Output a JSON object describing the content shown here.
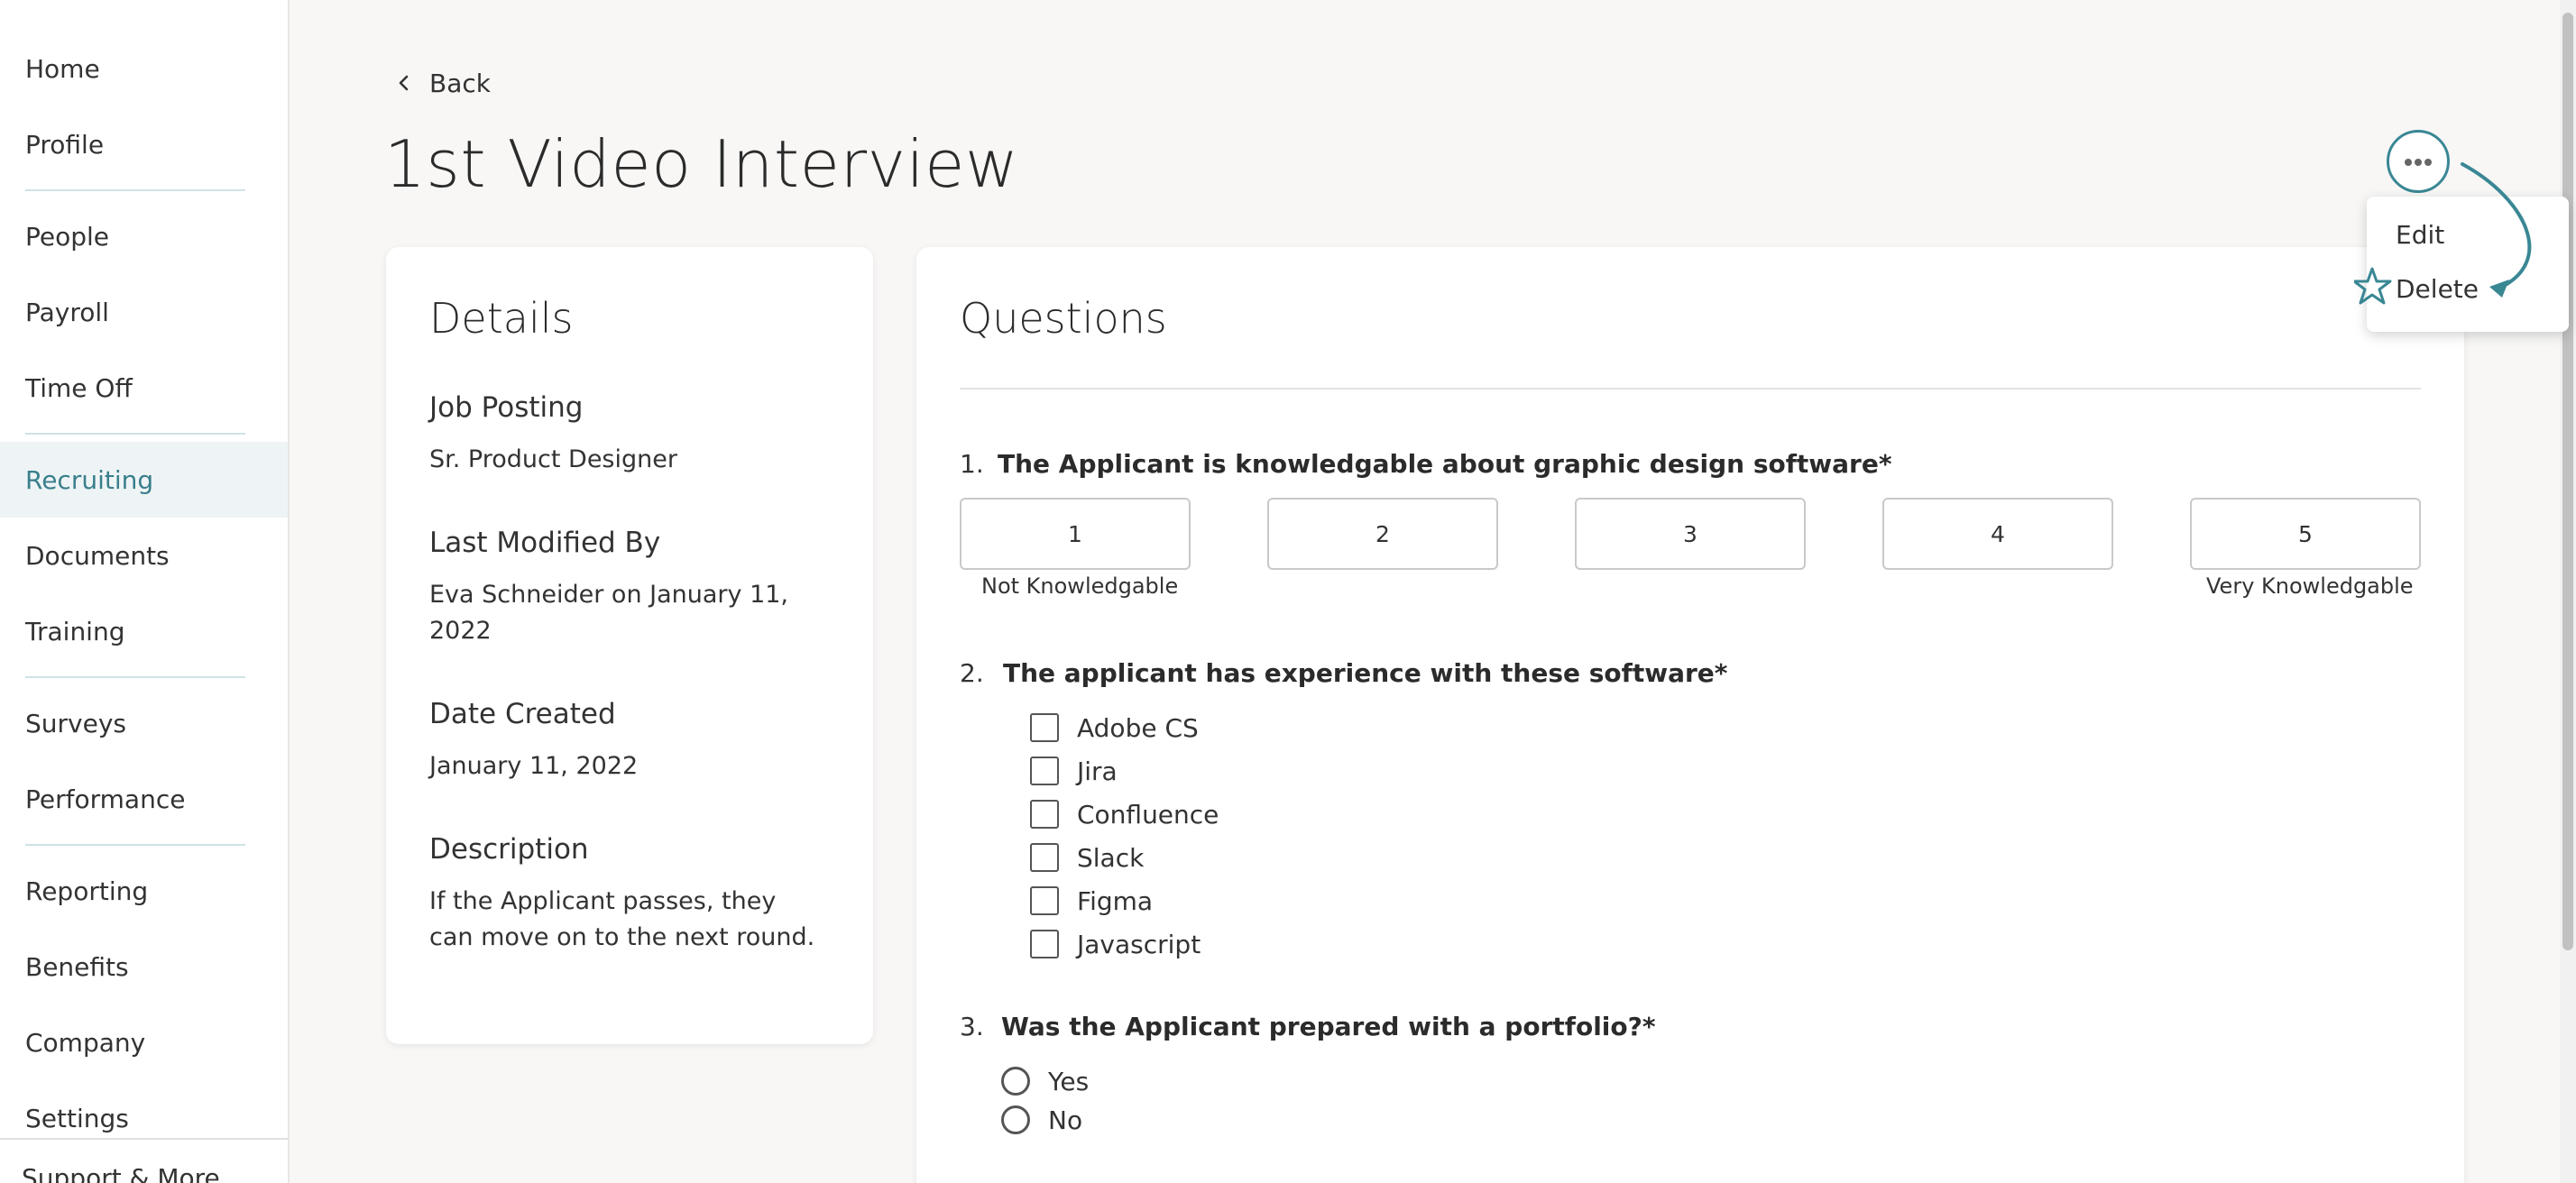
{
  "sidebar": {
    "items": [
      {
        "label": "Home"
      },
      {
        "label": "Profile"
      },
      {
        "label": "People"
      },
      {
        "label": "Payroll"
      },
      {
        "label": "Time Off"
      },
      {
        "label": "Recruiting"
      },
      {
        "label": "Documents"
      },
      {
        "label": "Training"
      },
      {
        "label": "Surveys"
      },
      {
        "label": "Performance"
      },
      {
        "label": "Reporting"
      },
      {
        "label": "Benefits"
      },
      {
        "label": "Company"
      },
      {
        "label": "Settings"
      }
    ],
    "active": "Recruiting",
    "footer_label": "Support & More"
  },
  "header": {
    "back_label": "Back",
    "title": "1st Video Interview"
  },
  "menu": {
    "icon": "more-horizontal-icon",
    "items": [
      {
        "label": "Edit"
      },
      {
        "label": "Delete"
      }
    ]
  },
  "details": {
    "heading": "Details",
    "job_posting_label": "Job Posting",
    "job_posting_value": "Sr. Product Designer",
    "last_modified_label": "Last Modified By",
    "last_modified_value": "Eva Schneider on January 11, 2022",
    "date_created_label": "Date Created",
    "date_created_value": "January 11, 2022",
    "description_label": "Description",
    "description_value": "If the Applicant passes, they can move on to the next round."
  },
  "questions": {
    "heading": "Questions",
    "q1": {
      "number": "1.",
      "text": "The Applicant is knowledgable about graphic design software*",
      "scale": [
        "1",
        "2",
        "3",
        "4",
        "5"
      ],
      "min_label": "Not Knowledgable",
      "max_label": "Very Knowledgable"
    },
    "q2": {
      "number": "2.",
      "text": "The applicant has experience with these software*",
      "options": [
        "Adobe CS",
        "Jira",
        "Confluence",
        "Slack",
        "Figma",
        "Javascript"
      ]
    },
    "q3": {
      "number": "3.",
      "text": "Was the Applicant prepared with a portfolio?*",
      "options": [
        "Yes",
        "No"
      ]
    }
  },
  "colors": {
    "accent": "#3a8794",
    "active_nav_bg": "#eef4f5",
    "page_bg": "#f8f7f6"
  }
}
